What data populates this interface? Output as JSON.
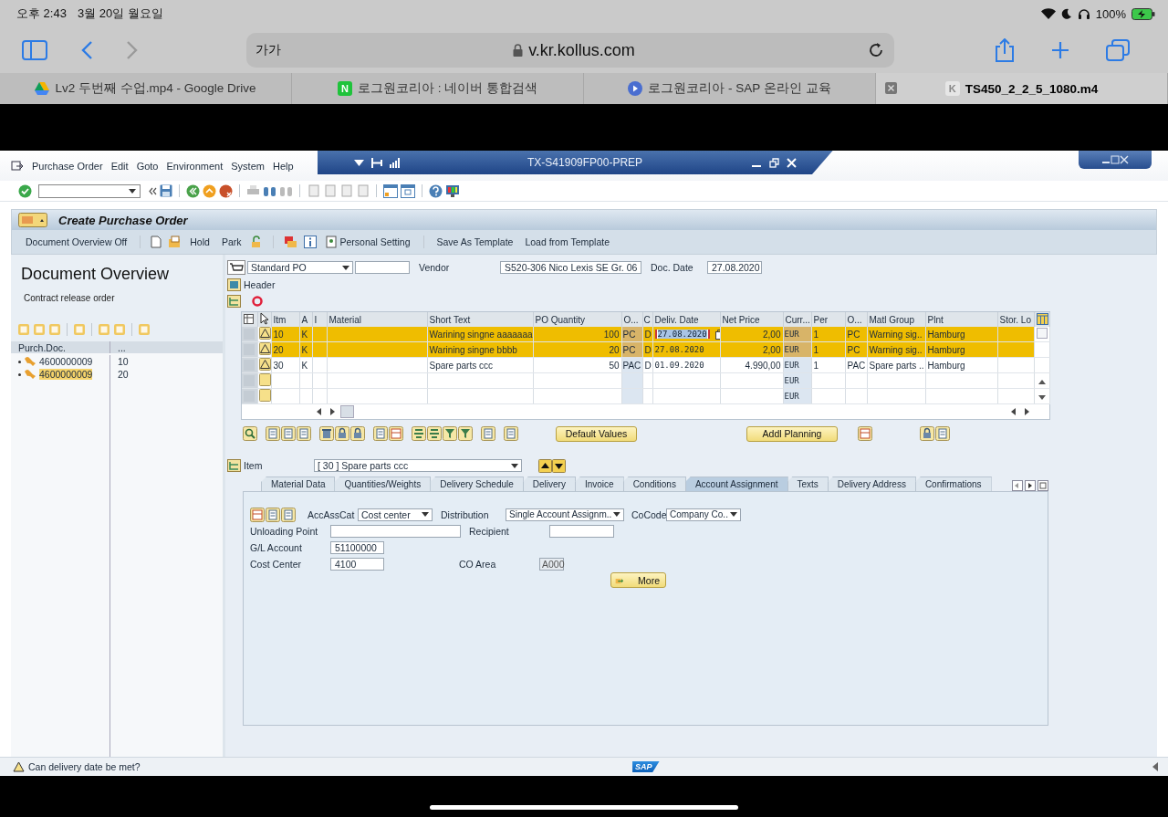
{
  "device_status": {
    "time": "오후 2:43",
    "date": "3월 20일 월요일",
    "battery": "100%"
  },
  "browser": {
    "text_size": "가가",
    "url": "v.kr.kollus.com",
    "tabs": [
      {
        "title": "Lv2 두번째 수업.mp4 - Google Drive",
        "selected": false,
        "kind": "drive"
      },
      {
        "title": "로그원코리아 : 네이버 통합검색",
        "selected": false,
        "kind": "letter",
        "favicon_text": "N"
      },
      {
        "title": "로그원코리아 - SAP 온라인 교육",
        "selected": false,
        "kind": "play"
      },
      {
        "title": "TS450_2_2_5_1080.m4",
        "selected": true,
        "kind": "letter",
        "favicon_text": "K"
      }
    ]
  },
  "sap": {
    "menu": [
      "Purchase Order",
      "Edit",
      "Goto",
      "Environment",
      "System",
      "Help"
    ],
    "system_title": "TX-S41909FP00-PREP",
    "screen_title": "Create Purchase Order",
    "app_toolbar": [
      {
        "label": "Document Overview Off"
      },
      {
        "label": "Hold"
      },
      {
        "label": "Park"
      },
      {
        "label": "Personal Setting"
      },
      {
        "label": "Save As Template"
      },
      {
        "label": "Load from Template"
      }
    ],
    "overview": {
      "title": "Document Overview",
      "subtitle": "Contract release order",
      "columns": [
        "Purch.Doc.",
        "..."
      ],
      "rows": [
        {
          "document": "4600000009",
          "item": "10",
          "selected": false
        },
        {
          "document": "4600000009",
          "item": "20",
          "selected": true
        }
      ]
    },
    "header": {
      "doc_type": "Standard PO",
      "vendor_label": "Vendor",
      "vendor": "S520-306 Nico Lexis SE Gr. 06",
      "date_label": "Doc. Date",
      "date": "27.08.2020",
      "header_label": "Header"
    },
    "items_table": {
      "columns": [
        "Itm",
        "A",
        "I",
        "Material",
        "Short Text",
        "PO Quantity",
        "O...",
        "C",
        "Deliv. Date",
        "Net Price",
        "Curr...",
        "Per",
        "O...",
        "Matl Group",
        "Plnt",
        "Stor. Lo"
      ],
      "rows": [
        {
          "selected": true,
          "warning": true,
          "date_focused": true,
          "cells": [
            "10",
            "K",
            null,
            null,
            "Warining singne  aaaaaaa",
            "100",
            "PC",
            "D",
            "27.08.2020",
            "2,00",
            "EUR",
            "1",
            "PC",
            "Warning sig..",
            "Hamburg",
            null
          ]
        },
        {
          "selected": true,
          "warning": true,
          "date_focused": false,
          "cells": [
            "20",
            "K",
            null,
            null,
            "Warining singne bbbb",
            "20",
            "PC",
            "D",
            "27.08.2020",
            "2,00",
            "EUR",
            "1",
            "PC",
            "Warning sig..",
            "Hamburg",
            null
          ]
        },
        {
          "selected": false,
          "warning": true,
          "date_focused": false,
          "cells": [
            "30",
            "K",
            null,
            null,
            "Spare parts ccc",
            "50",
            "PAC",
            "D",
            "01.09.2020",
            "4.990,00",
            "EUR",
            "1",
            "PAC",
            "Spare parts ..",
            "Hamburg",
            null
          ]
        },
        {
          "selected": false,
          "warning": false,
          "date_focused": false,
          "cells": [
            null,
            null,
            null,
            null,
            null,
            null,
            null,
            null,
            null,
            null,
            "EUR",
            null,
            null,
            null,
            null,
            null
          ]
        },
        {
          "selected": false,
          "warning": false,
          "date_focused": false,
          "cells": [
            null,
            null,
            null,
            null,
            null,
            null,
            null,
            null,
            null,
            null,
            "EUR",
            null,
            null,
            null,
            null,
            null
          ]
        }
      ]
    },
    "table_buttons": [
      "Default Values",
      "Addl Planning"
    ],
    "item_selector": {
      "label": "Item",
      "value": "[ 30 ] Spare parts ccc"
    },
    "detail_tabs": [
      {
        "label": "Material Data",
        "selected": false
      },
      {
        "label": "Quantities/Weights",
        "selected": false
      },
      {
        "label": "Delivery Schedule",
        "selected": false
      },
      {
        "label": "Delivery",
        "selected": false
      },
      {
        "label": "Invoice",
        "selected": false
      },
      {
        "label": "Conditions",
        "selected": false
      },
      {
        "label": "Account Assignment",
        "selected": true
      },
      {
        "label": "Texts",
        "selected": false
      },
      {
        "label": "Delivery Address",
        "selected": false
      },
      {
        "label": "Confirmations",
        "selected": false
      }
    ],
    "assignment": {
      "category": {
        "label": "AccAssCat",
        "value": "Cost center"
      },
      "distribution": {
        "label": "Distribution",
        "value": "Single Account Assignm.."
      },
      "company_code": {
        "label": "CoCode",
        "value": "Company Co.."
      },
      "unloading_point": {
        "label": "Unloading Point"
      },
      "recipient": {
        "label": "Recipient"
      },
      "gl_account": {
        "label": "G/L Account",
        "value": "51100000"
      },
      "cost_center": {
        "label": "Cost Center",
        "value": "4100"
      },
      "co_area": {
        "label": "CO Area",
        "value": "A000"
      },
      "more_button": "More"
    },
    "status_message": "Can delivery date be met?",
    "logo": "SAP"
  }
}
